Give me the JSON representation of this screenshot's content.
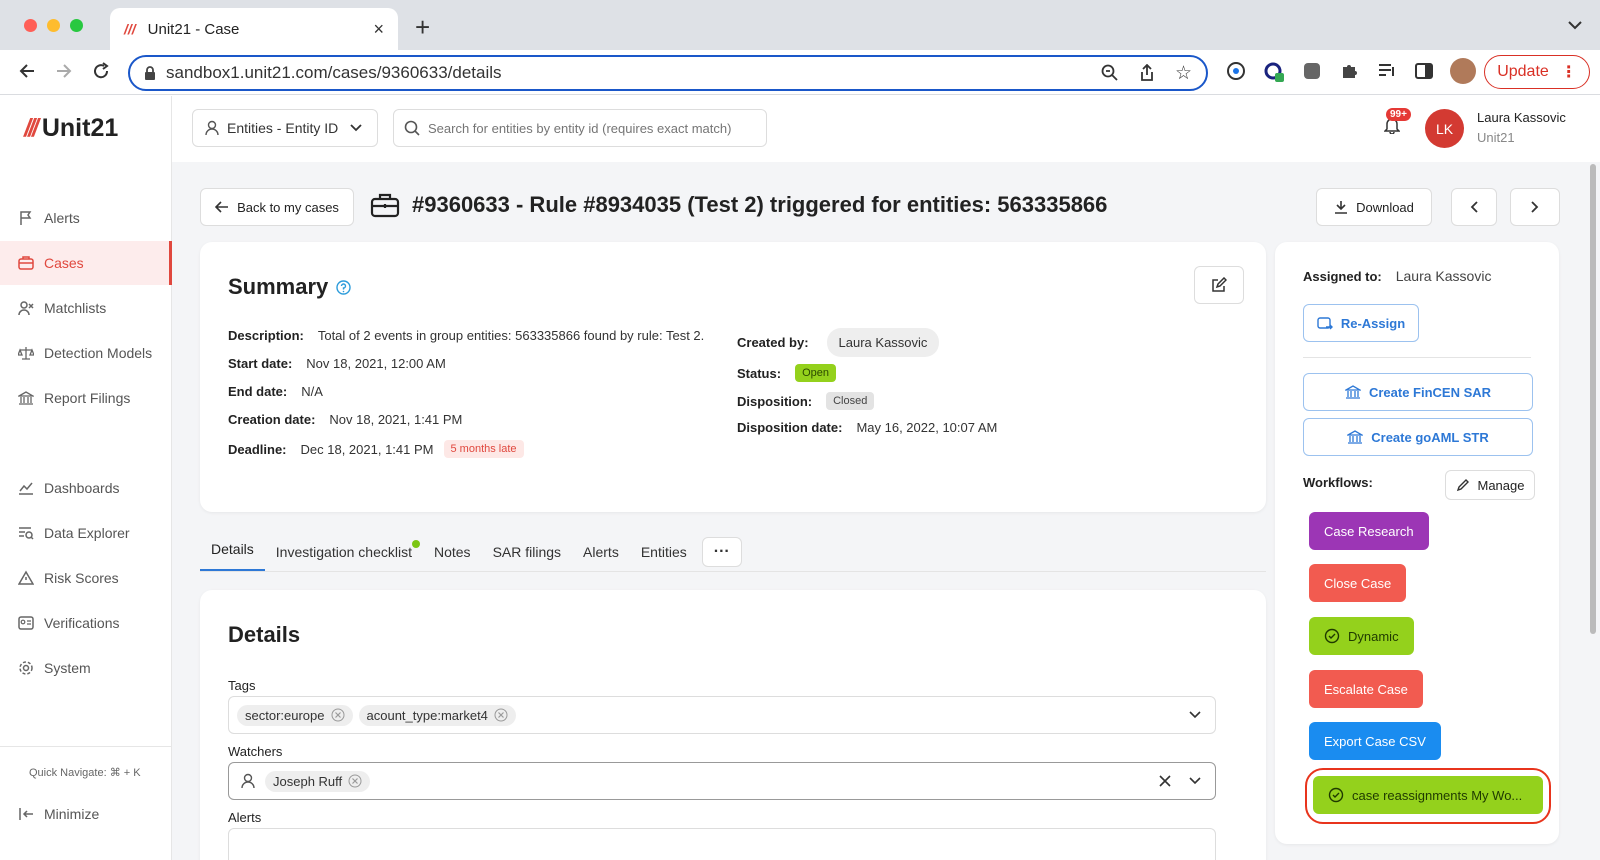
{
  "browser": {
    "tab_title": "Unit21 - Case",
    "url": "sandbox1.unit21.com/cases/9360633/details",
    "update_label": "Update"
  },
  "app": {
    "logo_text": "Unit21",
    "brand_color": "#e0483e"
  },
  "sidebar": {
    "items": [
      {
        "label": "Alerts",
        "icon": "flag-icon"
      },
      {
        "label": "Cases",
        "icon": "briefcase-icon",
        "active": true
      },
      {
        "label": "Matchlists",
        "icon": "user-x-icon"
      },
      {
        "label": "Detection Models",
        "icon": "scale-icon"
      },
      {
        "label": "Report Filings",
        "icon": "bank-icon"
      },
      {
        "label": "Dashboards",
        "icon": "chart-line-icon"
      },
      {
        "label": "Data Explorer",
        "icon": "table-search-icon"
      },
      {
        "label": "Risk Scores",
        "icon": "warning-icon"
      },
      {
        "label": "Verifications",
        "icon": "id-card-icon"
      },
      {
        "label": "System",
        "icon": "gear-icon"
      }
    ],
    "quick_navigate": "Quick Navigate: ⌘ + K",
    "minimize": "Minimize"
  },
  "topbar": {
    "entity_selector": "Entities - Entity ID",
    "search_placeholder": "Search for entities by entity id (requires exact match)",
    "notifications_badge": "99+",
    "user_initials": "LK",
    "user_name": "Laura Kassovic",
    "user_org": "Unit21"
  },
  "header": {
    "back_label": "Back to my cases",
    "title": "#9360633 - Rule #8934035 (Test 2) triggered for entities: 563335866",
    "download_label": "Download"
  },
  "summary": {
    "title": "Summary",
    "description_label": "Description:",
    "description": "Total of 2 events in group entities: 563335866 found by rule: Test 2.",
    "start_label": "Start date:",
    "start": "Nov 18, 2021, 12:00 AM",
    "end_label": "End date:",
    "end": "N/A",
    "creation_label": "Creation date:",
    "creation": "Nov 18, 2021, 1:41 PM",
    "deadline_label": "Deadline:",
    "deadline": "Dec 18, 2021, 1:41 PM",
    "late_badge": "5 months late",
    "created_by_label": "Created by:",
    "created_by": "Laura Kassovic",
    "status_label": "Status:",
    "status": "Open",
    "disposition_label": "Disposition:",
    "disposition": "Closed",
    "disposition_date_label": "Disposition date:",
    "disposition_date": "May 16, 2022, 10:07 AM"
  },
  "tabs": [
    "Details",
    "Investigation checklist",
    "Notes",
    "SAR filings",
    "Alerts",
    "Entities"
  ],
  "details": {
    "title": "Details",
    "tags_label": "Tags",
    "tags": [
      "sector:europe",
      "acount_type:market4"
    ],
    "watchers_label": "Watchers",
    "watchers": [
      "Joseph Ruff"
    ],
    "alerts_label": "Alerts"
  },
  "right_panel": {
    "assigned_label": "Assigned to:",
    "assigned": "Laura Kassovic",
    "reassign": "Re-Assign",
    "fincen": "Create FinCEN SAR",
    "goaml": "Create goAML STR",
    "workflows_label": "Workflows:",
    "manage": "Manage",
    "workflows": [
      {
        "label": "Case Research",
        "color": "#9c36b5"
      },
      {
        "label": "Close Case",
        "color": "#f25b50"
      },
      {
        "label": "Dynamic",
        "color": "#94d11c"
      },
      {
        "label": "Escalate Case",
        "color": "#f25b50"
      },
      {
        "label": "Export Case CSV",
        "color": "#1a8cf0"
      },
      {
        "label": "case reassignments My Wo...",
        "color": "#94d11c"
      }
    ]
  }
}
